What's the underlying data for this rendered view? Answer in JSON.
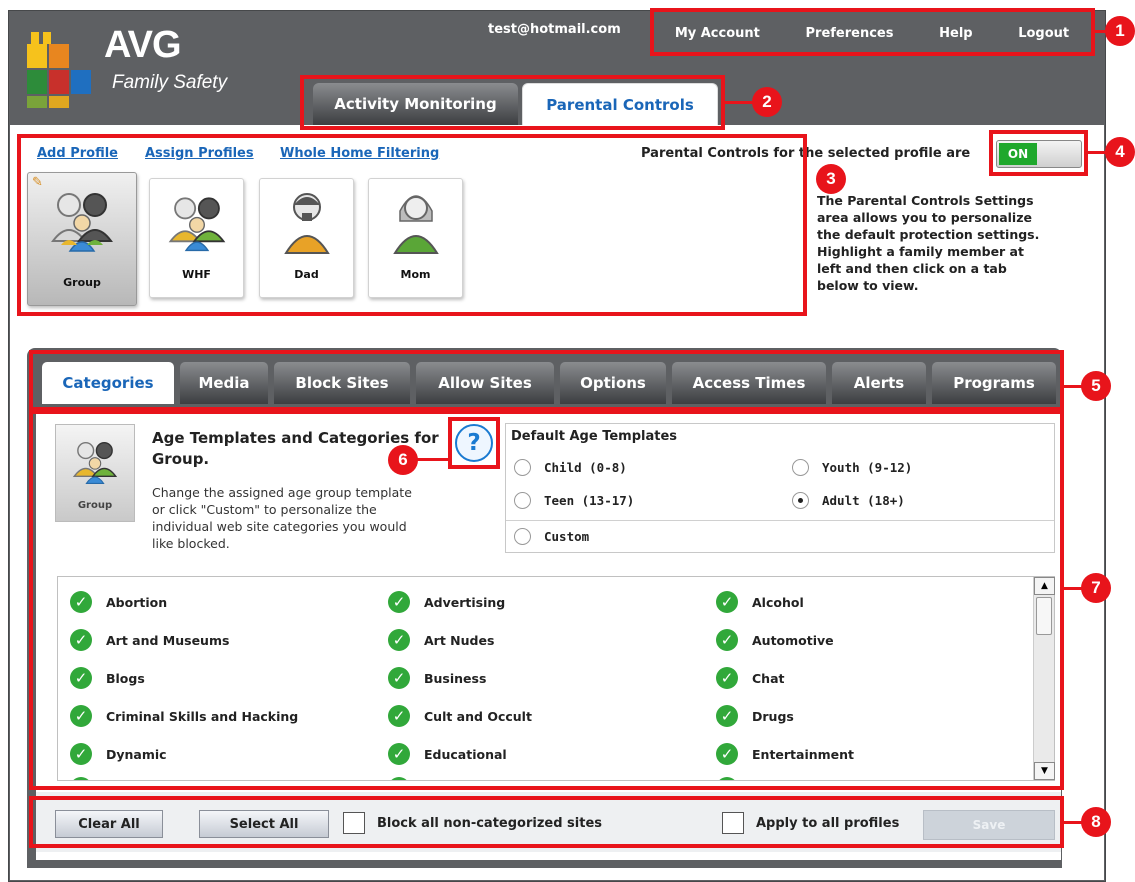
{
  "header": {
    "email": "test@hotmail.com",
    "nav": [
      "My Account",
      "Preferences",
      "Help",
      "Logout"
    ],
    "logo": {
      "brand": "AVG",
      "product": "Family Safety"
    }
  },
  "main_tabs": [
    "Activity Monitoring",
    "Parental Controls"
  ],
  "links": [
    "Add Profile",
    "Assign Profiles",
    "Whole Home Filtering"
  ],
  "parental_status": {
    "label": "Parental Controls for the selected profile are",
    "toggle": "ON"
  },
  "help_text": "The Parental Controls Settings area allows you to personalize the default protection settings. Highlight a family member at left and then click on a tab below to view.",
  "profiles": [
    {
      "name": "Group",
      "icon": "group-icon",
      "selected": true
    },
    {
      "name": "WHF",
      "icon": "family-icon",
      "selected": false
    },
    {
      "name": "Dad",
      "icon": "man-icon",
      "selected": false
    },
    {
      "name": "Mom",
      "icon": "woman-icon",
      "selected": false
    }
  ],
  "sub_tabs": [
    "Categories",
    "Media",
    "Block Sites",
    "Allow Sites",
    "Options",
    "Access Times",
    "Alerts",
    "Programs"
  ],
  "age": {
    "icon_label": "Group",
    "title": "Age Templates and Categories for Group.",
    "description": "Change the assigned age group template or click \"Custom\" to personalize the individual web site categories you would like blocked."
  },
  "templates": {
    "heading": "Default Age Templates",
    "options": [
      "Child (0-8)",
      "Youth (9-12)",
      "Teen (13-17)",
      "Adult (18+)",
      "Custom"
    ],
    "selected": "Adult (18+)"
  },
  "categories": [
    "Abortion",
    "Advertising",
    "Alcohol",
    "Art and Museums",
    "Art Nudes",
    "Automotive",
    "Blogs",
    "Business",
    "Chat",
    "Criminal Skills and Hacking",
    "Cult and Occult",
    "Drugs",
    "Dynamic",
    "Educational",
    "Entertainment"
  ],
  "bottom": {
    "clear_all": "Clear All",
    "select_all": "Select All",
    "block_noncategorized": "Block all non-categorized sites",
    "apply_all": "Apply to all profiles",
    "save": "Save"
  },
  "callouts": [
    "1",
    "2",
    "3",
    "4",
    "5",
    "6",
    "7",
    "8"
  ],
  "colors": {
    "accent_red": "#e8141b",
    "link_blue": "#1a66b8",
    "check_green": "#31a83a",
    "header_gray": "#5e6063"
  }
}
